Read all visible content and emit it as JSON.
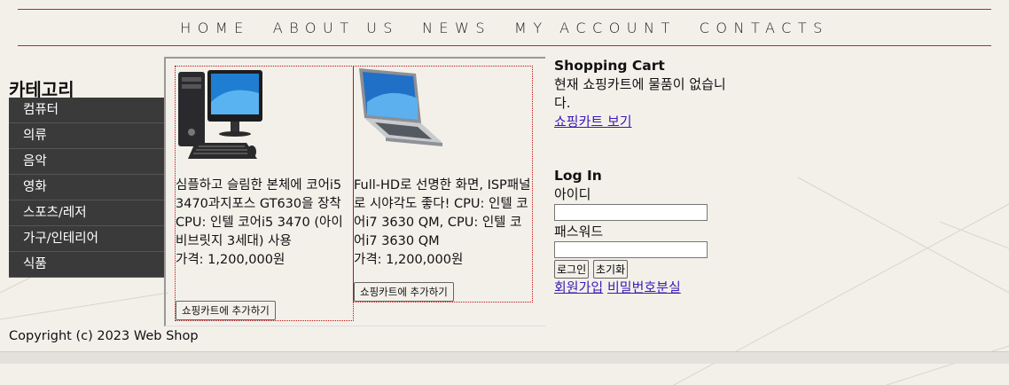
{
  "nav": {
    "items": [
      "HOME",
      "ABOUT US",
      "NEWS",
      "MY ACCOUNT",
      "CONTACTS"
    ]
  },
  "sidebar": {
    "title": "카테고리",
    "items": [
      "컴퓨터",
      "의류",
      "음악",
      "영화",
      "스포츠/레저",
      "가구/인테리어",
      "식품"
    ]
  },
  "products": [
    {
      "image": "desktop-computer-image",
      "description": "심플하고 슬림한 본체에 코어i5 3470과지포스 GT630을 장착 CPU: 인텔 코어i5 3470 (아이비브릿지 3세대) 사용",
      "price": "가격: 1,200,000원",
      "button": "쇼핑카트에 추가하기"
    },
    {
      "image": "laptop-image",
      "description": "Full-HD로 선명한 화면, ISP패널로 시야각도 좋다! CPU: 인텔 코어i7 3630 QM, CPU: 인텔 코어i7 3630 QM",
      "price": "가격: 1,200,000원",
      "button": "쇼핑카트에 추가하기"
    }
  ],
  "cart": {
    "title": "Shopping Cart",
    "message": "현재 쇼핑카트에 물품이 없습니다.",
    "link": "쇼핑카트 보기"
  },
  "login": {
    "title": "Log In",
    "id_label": "아이디",
    "id_value": "",
    "pw_label": "패스워드",
    "pw_value": "",
    "login_button": "로그인",
    "reset_button": "초기화",
    "signup_link": "회원가입",
    "forgot_link": "비밀번호분실"
  },
  "footer": {
    "copyright": "Copyright (c) 2023 Web Shop"
  },
  "colors": {
    "background": "#f3f0ea",
    "nav_rule": "#c82020",
    "sidebar_bg": "#3a3a3a",
    "link": "#3a1ab5"
  }
}
